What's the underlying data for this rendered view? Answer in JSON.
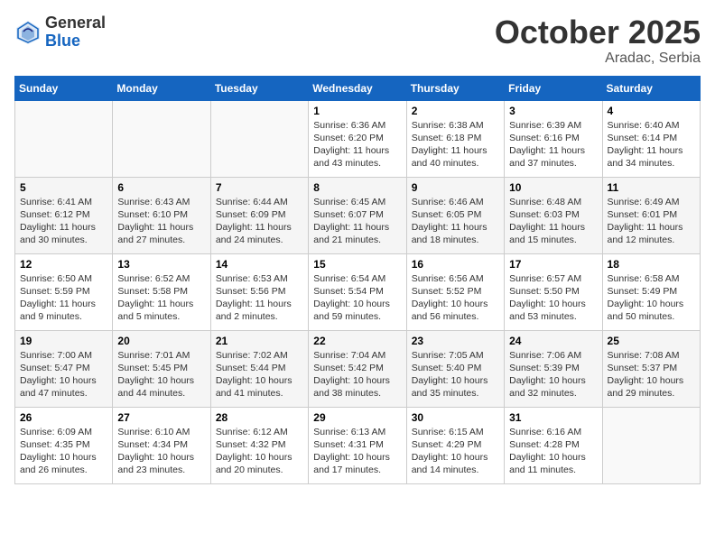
{
  "logo": {
    "general": "General",
    "blue": "Blue"
  },
  "header": {
    "month_year": "October 2025",
    "location": "Aradac, Serbia"
  },
  "weekdays": [
    "Sunday",
    "Monday",
    "Tuesday",
    "Wednesday",
    "Thursday",
    "Friday",
    "Saturday"
  ],
  "weeks": [
    [
      {
        "day": "",
        "sunrise": "",
        "sunset": "",
        "daylight": ""
      },
      {
        "day": "",
        "sunrise": "",
        "sunset": "",
        "daylight": ""
      },
      {
        "day": "",
        "sunrise": "",
        "sunset": "",
        "daylight": ""
      },
      {
        "day": "1",
        "sunrise": "Sunrise: 6:36 AM",
        "sunset": "Sunset: 6:20 PM",
        "daylight": "Daylight: 11 hours and 43 minutes."
      },
      {
        "day": "2",
        "sunrise": "Sunrise: 6:38 AM",
        "sunset": "Sunset: 6:18 PM",
        "daylight": "Daylight: 11 hours and 40 minutes."
      },
      {
        "day": "3",
        "sunrise": "Sunrise: 6:39 AM",
        "sunset": "Sunset: 6:16 PM",
        "daylight": "Daylight: 11 hours and 37 minutes."
      },
      {
        "day": "4",
        "sunrise": "Sunrise: 6:40 AM",
        "sunset": "Sunset: 6:14 PM",
        "daylight": "Daylight: 11 hours and 34 minutes."
      }
    ],
    [
      {
        "day": "5",
        "sunrise": "Sunrise: 6:41 AM",
        "sunset": "Sunset: 6:12 PM",
        "daylight": "Daylight: 11 hours and 30 minutes."
      },
      {
        "day": "6",
        "sunrise": "Sunrise: 6:43 AM",
        "sunset": "Sunset: 6:10 PM",
        "daylight": "Daylight: 11 hours and 27 minutes."
      },
      {
        "day": "7",
        "sunrise": "Sunrise: 6:44 AM",
        "sunset": "Sunset: 6:09 PM",
        "daylight": "Daylight: 11 hours and 24 minutes."
      },
      {
        "day": "8",
        "sunrise": "Sunrise: 6:45 AM",
        "sunset": "Sunset: 6:07 PM",
        "daylight": "Daylight: 11 hours and 21 minutes."
      },
      {
        "day": "9",
        "sunrise": "Sunrise: 6:46 AM",
        "sunset": "Sunset: 6:05 PM",
        "daylight": "Daylight: 11 hours and 18 minutes."
      },
      {
        "day": "10",
        "sunrise": "Sunrise: 6:48 AM",
        "sunset": "Sunset: 6:03 PM",
        "daylight": "Daylight: 11 hours and 15 minutes."
      },
      {
        "day": "11",
        "sunrise": "Sunrise: 6:49 AM",
        "sunset": "Sunset: 6:01 PM",
        "daylight": "Daylight: 11 hours and 12 minutes."
      }
    ],
    [
      {
        "day": "12",
        "sunrise": "Sunrise: 6:50 AM",
        "sunset": "Sunset: 5:59 PM",
        "daylight": "Daylight: 11 hours and 9 minutes."
      },
      {
        "day": "13",
        "sunrise": "Sunrise: 6:52 AM",
        "sunset": "Sunset: 5:58 PM",
        "daylight": "Daylight: 11 hours and 5 minutes."
      },
      {
        "day": "14",
        "sunrise": "Sunrise: 6:53 AM",
        "sunset": "Sunset: 5:56 PM",
        "daylight": "Daylight: 11 hours and 2 minutes."
      },
      {
        "day": "15",
        "sunrise": "Sunrise: 6:54 AM",
        "sunset": "Sunset: 5:54 PM",
        "daylight": "Daylight: 10 hours and 59 minutes."
      },
      {
        "day": "16",
        "sunrise": "Sunrise: 6:56 AM",
        "sunset": "Sunset: 5:52 PM",
        "daylight": "Daylight: 10 hours and 56 minutes."
      },
      {
        "day": "17",
        "sunrise": "Sunrise: 6:57 AM",
        "sunset": "Sunset: 5:50 PM",
        "daylight": "Daylight: 10 hours and 53 minutes."
      },
      {
        "day": "18",
        "sunrise": "Sunrise: 6:58 AM",
        "sunset": "Sunset: 5:49 PM",
        "daylight": "Daylight: 10 hours and 50 minutes."
      }
    ],
    [
      {
        "day": "19",
        "sunrise": "Sunrise: 7:00 AM",
        "sunset": "Sunset: 5:47 PM",
        "daylight": "Daylight: 10 hours and 47 minutes."
      },
      {
        "day": "20",
        "sunrise": "Sunrise: 7:01 AM",
        "sunset": "Sunset: 5:45 PM",
        "daylight": "Daylight: 10 hours and 44 minutes."
      },
      {
        "day": "21",
        "sunrise": "Sunrise: 7:02 AM",
        "sunset": "Sunset: 5:44 PM",
        "daylight": "Daylight: 10 hours and 41 minutes."
      },
      {
        "day": "22",
        "sunrise": "Sunrise: 7:04 AM",
        "sunset": "Sunset: 5:42 PM",
        "daylight": "Daylight: 10 hours and 38 minutes."
      },
      {
        "day": "23",
        "sunrise": "Sunrise: 7:05 AM",
        "sunset": "Sunset: 5:40 PM",
        "daylight": "Daylight: 10 hours and 35 minutes."
      },
      {
        "day": "24",
        "sunrise": "Sunrise: 7:06 AM",
        "sunset": "Sunset: 5:39 PM",
        "daylight": "Daylight: 10 hours and 32 minutes."
      },
      {
        "day": "25",
        "sunrise": "Sunrise: 7:08 AM",
        "sunset": "Sunset: 5:37 PM",
        "daylight": "Daylight: 10 hours and 29 minutes."
      }
    ],
    [
      {
        "day": "26",
        "sunrise": "Sunrise: 6:09 AM",
        "sunset": "Sunset: 4:35 PM",
        "daylight": "Daylight: 10 hours and 26 minutes."
      },
      {
        "day": "27",
        "sunrise": "Sunrise: 6:10 AM",
        "sunset": "Sunset: 4:34 PM",
        "daylight": "Daylight: 10 hours and 23 minutes."
      },
      {
        "day": "28",
        "sunrise": "Sunrise: 6:12 AM",
        "sunset": "Sunset: 4:32 PM",
        "daylight": "Daylight: 10 hours and 20 minutes."
      },
      {
        "day": "29",
        "sunrise": "Sunrise: 6:13 AM",
        "sunset": "Sunset: 4:31 PM",
        "daylight": "Daylight: 10 hours and 17 minutes."
      },
      {
        "day": "30",
        "sunrise": "Sunrise: 6:15 AM",
        "sunset": "Sunset: 4:29 PM",
        "daylight": "Daylight: 10 hours and 14 minutes."
      },
      {
        "day": "31",
        "sunrise": "Sunrise: 6:16 AM",
        "sunset": "Sunset: 4:28 PM",
        "daylight": "Daylight: 10 hours and 11 minutes."
      },
      {
        "day": "",
        "sunrise": "",
        "sunset": "",
        "daylight": ""
      }
    ]
  ]
}
